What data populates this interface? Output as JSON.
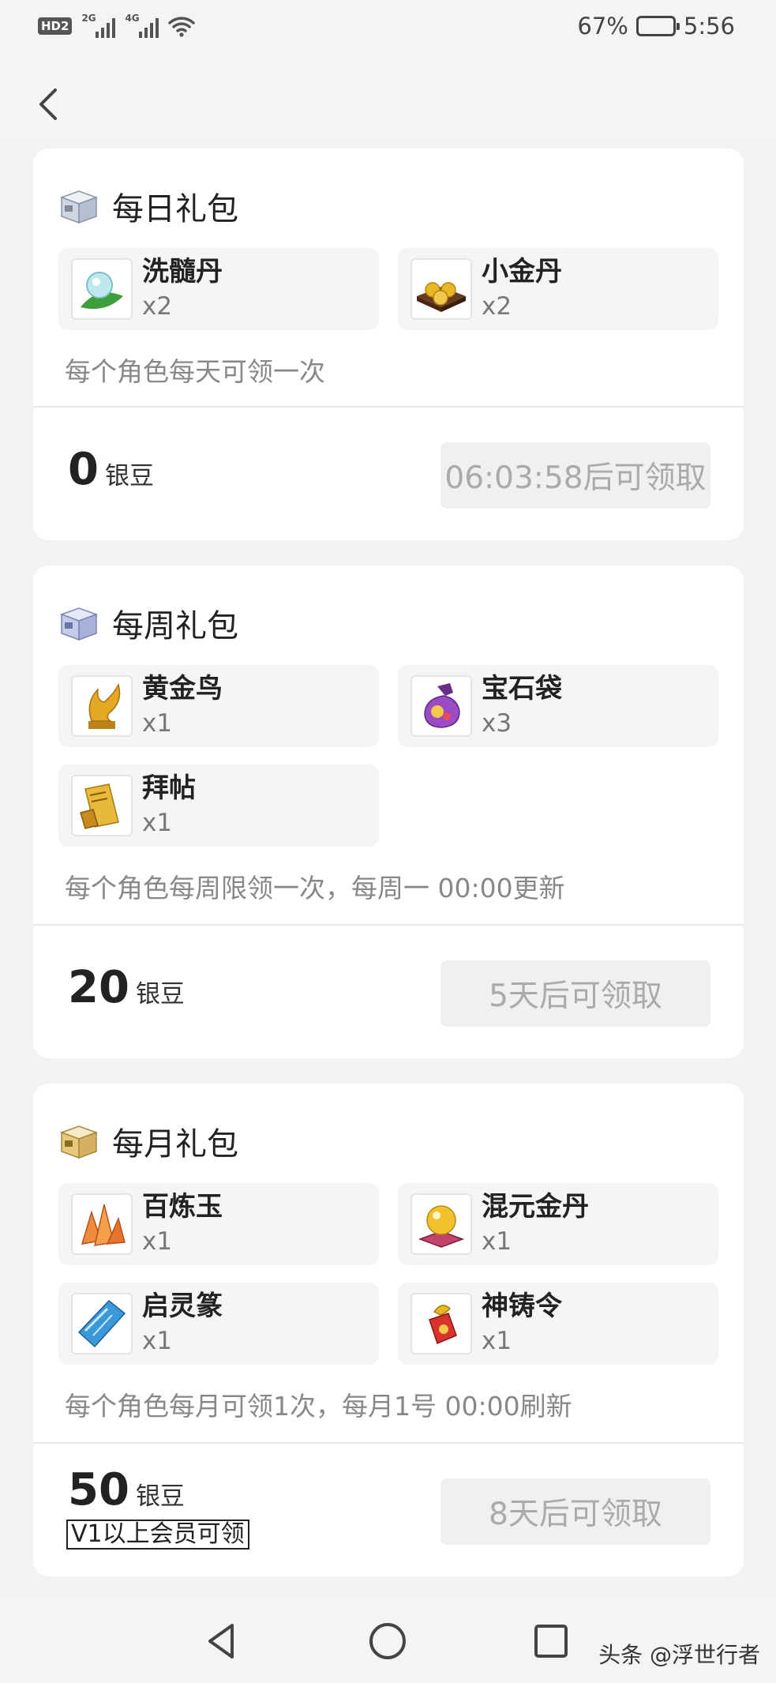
{
  "status_bar": {
    "hd_label": "HD",
    "hd_sub": "2",
    "net1": "2G",
    "net2": "4G",
    "battery_percent": "67%",
    "battery_level": 0.67,
    "time": "5:56"
  },
  "nav": {
    "back_icon": "chevron-left-icon"
  },
  "daily": {
    "title": "每日礼包",
    "items": [
      {
        "name": "洗髓丹",
        "qty": "x2",
        "icon": "pill-orb-icon"
      },
      {
        "name": "小金丹",
        "qty": "x2",
        "icon": "gold-pills-tray-icon"
      }
    ],
    "note": "每个角色每天可领一次",
    "price": "0",
    "unit": "银豆",
    "button": "06:03:58后可领取"
  },
  "weekly": {
    "title": "每周礼包",
    "items": [
      {
        "name": "黄金鸟",
        "qty": "x1",
        "icon": "golden-bird-icon"
      },
      {
        "name": "宝石袋",
        "qty": "x3",
        "icon": "gem-bag-icon"
      },
      {
        "name": "拜帖",
        "qty": "x1",
        "icon": "invitation-card-icon"
      }
    ],
    "note": "每个角色每周限领一次，每周一 00:00更新",
    "price": "20",
    "unit": "银豆",
    "button": "5天后可领取"
  },
  "monthly": {
    "title": "每月礼包",
    "items": [
      {
        "name": "百炼玉",
        "qty": "x1",
        "icon": "refined-jade-icon"
      },
      {
        "name": "混元金丹",
        "qty": "x1",
        "icon": "golden-orb-icon"
      },
      {
        "name": "启灵篆",
        "qty": "x1",
        "icon": "blue-scroll-icon"
      },
      {
        "name": "神铸令",
        "qty": "x1",
        "icon": "forge-token-icon"
      }
    ],
    "note": "每个角色每月可领1次，每月1号 00:00刷新",
    "price": "50",
    "unit": "银豆",
    "vip": "V1以上会员可领",
    "button": "8天后可领取"
  },
  "watermark": "头条 @浮世行者"
}
